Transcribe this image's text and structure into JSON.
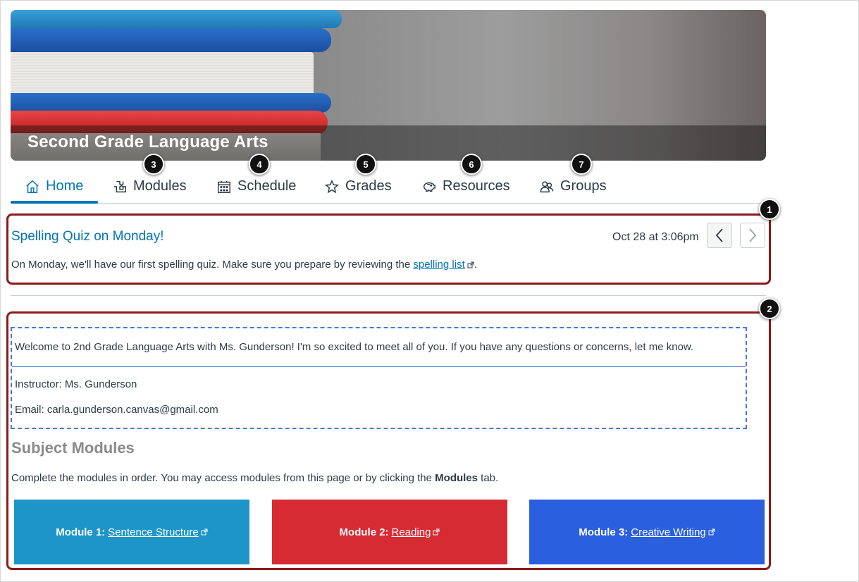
{
  "course": {
    "title": "Second Grade Language Arts"
  },
  "tabs": [
    {
      "label": "Home"
    },
    {
      "label": "Modules"
    },
    {
      "label": "Schedule"
    },
    {
      "label": "Grades"
    },
    {
      "label": "Resources"
    },
    {
      "label": "Groups"
    }
  ],
  "callouts": [
    "1",
    "2",
    "3",
    "4",
    "5",
    "6",
    "7"
  ],
  "announcement": {
    "title": "Spelling Quiz on Monday!",
    "date": "Oct 28 at 3:06pm",
    "body_prefix": "On Monday, we'll have our first spelling quiz. Make sure you prepare by reviewing the",
    "link_text": "spelling list",
    "body_suffix": "."
  },
  "welcome": {
    "message": "Welcome to 2nd Grade Language Arts with Ms. Gunderson! I'm so excited to meet all of you. If you have any questions or concerns, let me know.",
    "instructor": "Instructor: Ms. Gunderson",
    "email": "Email: carla.gunderson.canvas@gmail.com"
  },
  "subject": {
    "title": "Subject Modules",
    "desc_prefix": "Complete the modules in order. You may access modules from this page or by clicking the",
    "desc_bold": "Modules",
    "desc_suffix": "tab."
  },
  "modules": [
    {
      "prefix": "Module 1:",
      "link": "Sentence Structure",
      "color": "#1e95c8"
    },
    {
      "prefix": "Module 2:",
      "link": "Reading",
      "color": "#d62b33"
    },
    {
      "prefix": "Module 3:",
      "link": "Creative Writing",
      "color": "#2a5fe0"
    }
  ],
  "colors": {
    "accent": "#0374b5",
    "annotation": "#8b1a1a",
    "dashed": "#4a78d8"
  }
}
